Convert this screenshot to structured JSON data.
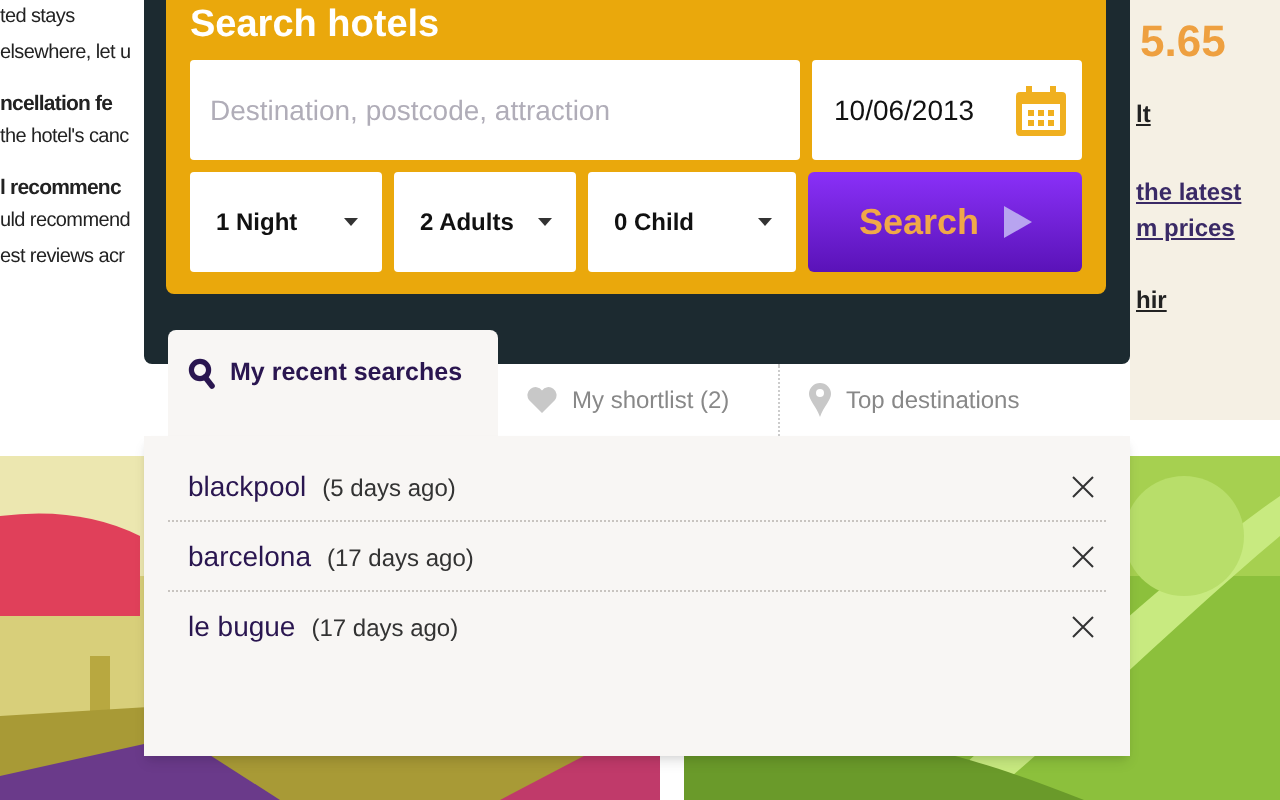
{
  "left_column": {
    "lines": [
      {
        "text": "ted stays",
        "bold": false
      },
      {
        "text": "elsewhere, let u",
        "bold": false
      },
      {
        "text": "ncellation fe",
        "bold": true
      },
      {
        "text": "the hotel's canc",
        "bold": false
      },
      {
        "text": "l recommenc",
        "bold": true
      },
      {
        "text": "uld recommend",
        "bold": false
      },
      {
        "text": "est reviews acr",
        "bold": false
      }
    ]
  },
  "right_column": {
    "price": "5.65",
    "links": [
      "lt",
      "the latest",
      "m prices",
      "hir"
    ]
  },
  "search": {
    "title": "Search hotels",
    "destination": {
      "placeholder": "Destination, postcode, attraction"
    },
    "date": {
      "value": "10/06/2013"
    },
    "selects": [
      {
        "value": "1 Night"
      },
      {
        "value": "2 Adults"
      },
      {
        "value": "0 Child"
      }
    ],
    "button": "Search"
  },
  "tabs": [
    {
      "label": "My recent searches",
      "selected": true
    },
    {
      "label": "My shortlist (2)",
      "selected": false
    },
    {
      "label": "Top destinations",
      "selected": false
    }
  ],
  "recent_searches": [
    {
      "place": "blackpool",
      "when": "(5 days ago)"
    },
    {
      "place": "barcelona",
      "when": "(17 days ago)"
    },
    {
      "place": "le bugue",
      "when": "(17 days ago)"
    }
  ]
}
